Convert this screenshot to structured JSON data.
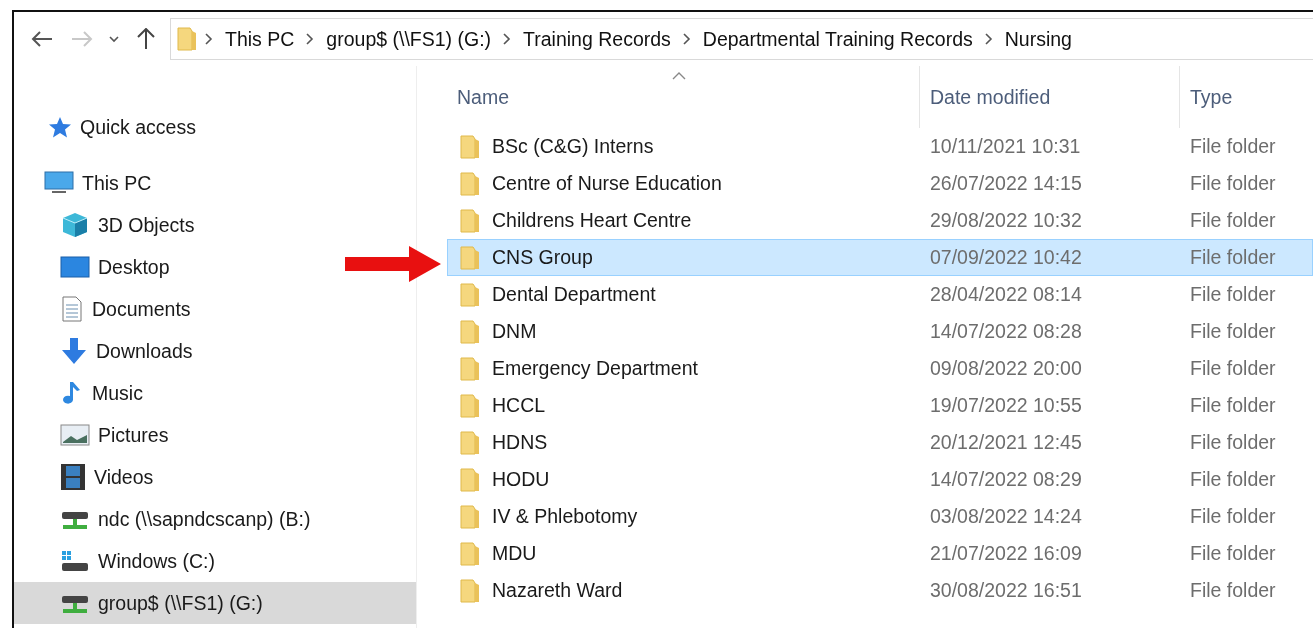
{
  "address_bar": {
    "crumbs": [
      "This PC",
      "group$ (\\\\FS1) (G:)",
      "Training Records",
      "Departmental Training Records",
      "Nursing"
    ]
  },
  "sidebar": {
    "items": [
      {
        "label": "Quick access",
        "kind": "star",
        "selected": false
      },
      {
        "label": "This PC",
        "kind": "pc",
        "selected": false,
        "children": [
          {
            "label": "3D Objects",
            "kind": "cube",
            "selected": false
          },
          {
            "label": "Desktop",
            "kind": "desktop",
            "selected": false
          },
          {
            "label": "Documents",
            "kind": "document",
            "selected": false
          },
          {
            "label": "Downloads",
            "kind": "download",
            "selected": false
          },
          {
            "label": "Music",
            "kind": "music",
            "selected": false
          },
          {
            "label": "Pictures",
            "kind": "picture",
            "selected": false
          },
          {
            "label": "Videos",
            "kind": "video",
            "selected": false
          },
          {
            "label": "ndc (\\\\sapndcscanp) (B:)",
            "kind": "netdrive",
            "selected": false
          },
          {
            "label": "Windows (C:)",
            "kind": "windrive",
            "selected": false
          },
          {
            "label": "group$ (\\\\FS1) (G:)",
            "kind": "netdrive",
            "selected": true
          }
        ]
      }
    ]
  },
  "table": {
    "columns": [
      "Name",
      "Date modified",
      "Type"
    ],
    "rows": [
      {
        "name": "BSc (C&G) Interns",
        "date": "10/11/2021 10:31",
        "type": "File folder",
        "selected": false
      },
      {
        "name": "Centre of Nurse Education",
        "date": "26/07/2022 14:15",
        "type": "File folder",
        "selected": false
      },
      {
        "name": "Childrens Heart Centre",
        "date": "29/08/2022 10:32",
        "type": "File folder",
        "selected": false
      },
      {
        "name": "CNS Group",
        "date": "07/09/2022 10:42",
        "type": "File folder",
        "selected": true
      },
      {
        "name": "Dental Department",
        "date": "28/04/2022 08:14",
        "type": "File folder",
        "selected": false
      },
      {
        "name": "DNM",
        "date": "14/07/2022 08:28",
        "type": "File folder",
        "selected": false
      },
      {
        "name": "Emergency Department",
        "date": "09/08/2022 20:00",
        "type": "File folder",
        "selected": false
      },
      {
        "name": "HCCL",
        "date": "19/07/2022 10:55",
        "type": "File folder",
        "selected": false
      },
      {
        "name": "HDNS",
        "date": "20/12/2021 12:45",
        "type": "File folder",
        "selected": false
      },
      {
        "name": "HODU",
        "date": "14/07/2022 08:29",
        "type": "File folder",
        "selected": false
      },
      {
        "name": "IV & Phlebotomy",
        "date": "03/08/2022 14:24",
        "type": "File folder",
        "selected": false
      },
      {
        "name": "MDU",
        "date": "21/07/2022 16:09",
        "type": "File folder",
        "selected": false
      },
      {
        "name": "Nazareth Ward",
        "date": "30/08/2022 16:51",
        "type": "File folder",
        "selected": false
      }
    ]
  }
}
